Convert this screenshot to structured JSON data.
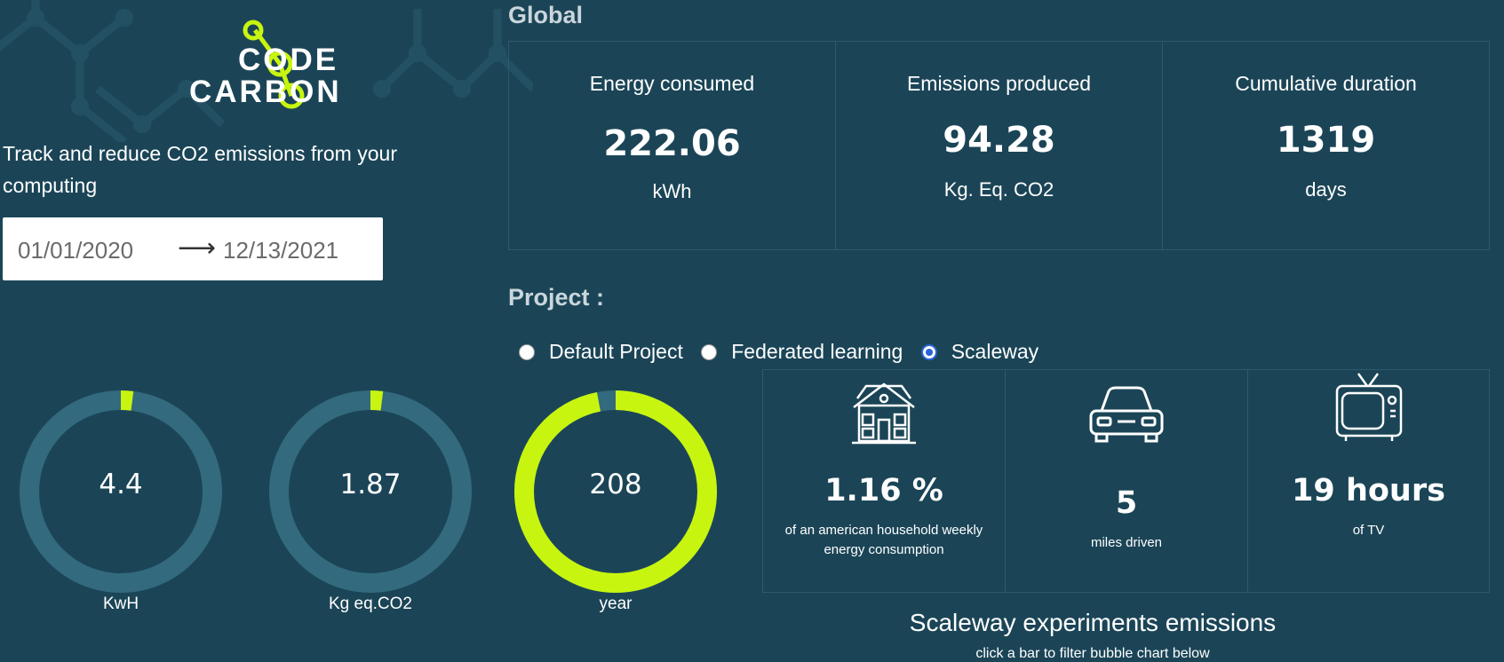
{
  "logo": {
    "line1": "CODE",
    "line2": "CARBON",
    "accent": "#c8f50f"
  },
  "tagline": "Track and reduce CO2 emissions from your computing",
  "date_range": {
    "start": "01/01/2020",
    "arrow": "⟶",
    "end": "12/13/2021"
  },
  "global": {
    "title": "Global",
    "cards": [
      {
        "title": "Energy consumed",
        "value": "222.06",
        "unit": "kWh"
      },
      {
        "title": "Emissions produced",
        "value": "94.28",
        "unit": "Kg. Eq. CO2"
      },
      {
        "title": "Cumulative duration",
        "value": "1319",
        "unit": "days"
      }
    ]
  },
  "project": {
    "title": "Project :",
    "options": [
      {
        "label": "Default Project",
        "selected": false
      },
      {
        "label": "Federated learning",
        "selected": false
      },
      {
        "label": "Scaleway",
        "selected": true
      }
    ]
  },
  "gauges": [
    {
      "value": "4.4",
      "label": "KwH",
      "fill_fraction": 0.02
    },
    {
      "value": "1.87",
      "label": "Kg eq.CO2",
      "fill_fraction": 0.02
    },
    {
      "value": "208",
      "label": "year",
      "fill_fraction": 0.97
    }
  ],
  "equivalents": [
    {
      "icon": "house-icon",
      "value": "1.16 %",
      "desc": "of an american household weekly energy consumption"
    },
    {
      "icon": "car-icon",
      "value": "5",
      "desc": "miles driven"
    },
    {
      "icon": "tv-icon",
      "value": "19 hours",
      "desc": "of TV"
    }
  ],
  "experiments": {
    "title": "Scaleway experiments emissions",
    "subtitle": "click a bar to filter bubble chart below"
  },
  "colors": {
    "background": "#1b4557",
    "accent": "#c8f50f",
    "track": "#336a7e"
  }
}
